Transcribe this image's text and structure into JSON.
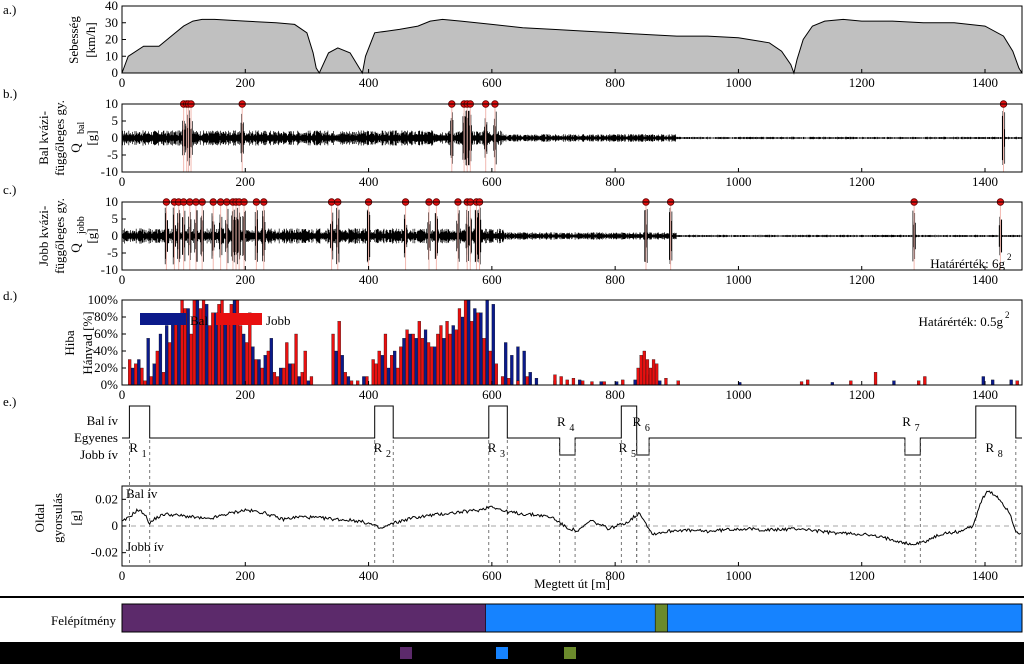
{
  "chart_data": [
    {
      "panel": "a.)",
      "type": "area",
      "ylabel_line1": "Sebesség",
      "ylabel_line2": "[km/h]",
      "xlim": [
        0,
        1460
      ],
      "ylim": [
        0,
        40
      ],
      "yticks": [
        0,
        10,
        20,
        30,
        40
      ],
      "xticks": [
        0,
        200,
        400,
        600,
        800,
        1000,
        1200,
        1400
      ],
      "color": "#c0c0c0",
      "x": [
        0,
        10,
        35,
        60,
        80,
        100,
        115,
        130,
        150,
        200,
        250,
        280,
        300,
        310,
        315,
        320,
        335,
        350,
        370,
        385,
        390,
        395,
        410,
        430,
        450,
        480,
        500,
        520,
        550,
        600,
        650,
        700,
        750,
        800,
        850,
        900,
        950,
        1000,
        1050,
        1070,
        1085,
        1090,
        1095,
        1105,
        1120,
        1140,
        1170,
        1200,
        1250,
        1300,
        1350,
        1400,
        1430,
        1445,
        1455,
        1460
      ],
      "y": [
        0,
        10,
        16,
        16,
        22,
        28,
        31,
        32,
        32,
        31,
        30,
        29,
        24,
        12,
        3,
        0,
        12,
        15,
        12,
        3,
        0,
        10,
        24,
        25,
        26,
        28,
        31,
        32,
        31,
        29,
        27,
        26,
        25,
        24,
        23,
        22,
        22,
        21,
        18,
        13,
        5,
        0,
        8,
        20,
        28,
        31,
        32,
        31,
        31,
        30,
        30,
        28,
        22,
        13,
        3,
        0
      ]
    },
    {
      "panel": "b.)",
      "type": "line",
      "ylabel_line1": "Bal kvázi-",
      "ylabel_line2": "függőleges gy.",
      "ylabel_line3": "Q",
      "ylabel_sub": "bal",
      "ylabel_unit": "[g]",
      "xlim": [
        0,
        1460
      ],
      "ylim": [
        -10,
        10
      ],
      "yticks": [
        -10,
        -5,
        0,
        5,
        10
      ],
      "xticks": [
        0,
        200,
        400,
        600,
        800,
        1000,
        1200,
        1400
      ],
      "exceedances_x": [
        100,
        105,
        108,
        112,
        195,
        535,
        555,
        560,
        565,
        590,
        605,
        1430
      ]
    },
    {
      "panel": "c.)",
      "type": "line",
      "ylabel_line1": "Jobb kvázi-",
      "ylabel_line2": "függőleges gy.",
      "ylabel_line3": "Q",
      "ylabel_sub": "jobb",
      "ylabel_unit": "[g]",
      "xlim": [
        0,
        1460
      ],
      "ylim": [
        -10,
        10
      ],
      "yticks": [
        -10,
        -5,
        0,
        5,
        10
      ],
      "xticks": [
        0,
        200,
        400,
        600,
        800,
        1000,
        1200,
        1400
      ],
      "annotation": "Határérték: 6g",
      "annotation_sup": "2",
      "exceedances_x": [
        72,
        85,
        92,
        100,
        110,
        120,
        130,
        148,
        160,
        170,
        180,
        185,
        190,
        198,
        218,
        230,
        340,
        350,
        400,
        460,
        498,
        510,
        545,
        560,
        565,
        575,
        580,
        850,
        890,
        1285,
        1425
      ]
    },
    {
      "panel": "d.)",
      "type": "bar",
      "ylabel_line1": "Hiba",
      "ylabel_line2": "Hányad [%]",
      "xlim": [
        0,
        1460
      ],
      "ylim": [
        0,
        100
      ],
      "yticks": [
        "0%",
        "20%",
        "40%",
        "60%",
        "80%",
        "100%"
      ],
      "xticks": [
        0,
        200,
        400,
        600,
        800,
        1000,
        1200,
        1400
      ],
      "legend": [
        "Bal",
        "Jobb"
      ],
      "legend_location": "top-left",
      "annotation": "Határérték: 0.5g",
      "annotation_sup": "2",
      "bin_width": 5,
      "series": [
        {
          "name": "Bal",
          "color": "#0b1a8a",
          "x": [
            15,
            25,
            40,
            50,
            60,
            70,
            80,
            90,
            105,
            120,
            135,
            150,
            165,
            180,
            195,
            210,
            220,
            230,
            240,
            255,
            270,
            285,
            300,
            345,
            355,
            365,
            390,
            420,
            430,
            440,
            455,
            465,
            475,
            490,
            505,
            520,
            535,
            550,
            560,
            570,
            580,
            590,
            600,
            620,
            630,
            640,
            650,
            660,
            670,
            700,
            740,
            775,
            800,
            830,
            850,
            870,
            1000,
            1150,
            1250,
            1395,
            1410,
            1440
          ],
          "values": [
            20,
            30,
            55,
            25,
            60,
            70,
            80,
            75,
            90,
            100,
            95,
            85,
            80,
            100,
            60,
            45,
            30,
            35,
            55,
            20,
            25,
            10,
            5,
            40,
            35,
            10,
            10,
            35,
            20,
            40,
            55,
            60,
            55,
            65,
            45,
            55,
            70,
            80,
            100,
            90,
            85,
            100,
            95,
            50,
            35,
            45,
            40,
            15,
            8,
            5,
            6,
            4,
            4,
            6,
            12,
            5,
            3,
            3,
            5,
            10,
            6,
            6
          ]
        },
        {
          "name": "Jobb",
          "color": "#e81010",
          "x": [
            10,
            20,
            30,
            35,
            45,
            55,
            65,
            75,
            85,
            95,
            100,
            110,
            115,
            125,
            130,
            140,
            145,
            155,
            160,
            170,
            175,
            185,
            190,
            200,
            205,
            215,
            225,
            235,
            245,
            250,
            260,
            265,
            275,
            280,
            290,
            295,
            305,
            340,
            350,
            360,
            370,
            380,
            395,
            405,
            410,
            415,
            425,
            435,
            445,
            450,
            460,
            470,
            480,
            485,
            495,
            500,
            510,
            515,
            525,
            530,
            540,
            545,
            555,
            565,
            575,
            585,
            595,
            605,
            615,
            625,
            640,
            655,
            700,
            710,
            720,
            730,
            745,
            760,
            780,
            810,
            835,
            840,
            845,
            850,
            855,
            860,
            865,
            880,
            900,
            1100,
            1110,
            1180,
            1220,
            1290,
            1300,
            1450
          ],
          "values": [
            30,
            25,
            20,
            5,
            10,
            40,
            15,
            50,
            75,
            100,
            90,
            60,
            100,
            90,
            100,
            70,
            85,
            95,
            100,
            80,
            95,
            100,
            70,
            50,
            85,
            30,
            20,
            40,
            15,
            10,
            20,
            50,
            25,
            60,
            15,
            40,
            10,
            60,
            75,
            15,
            5,
            5,
            10,
            30,
            25,
            40,
            60,
            35,
            20,
            45,
            65,
            60,
            75,
            55,
            50,
            45,
            60,
            70,
            75,
            60,
            65,
            90,
            100,
            75,
            85,
            55,
            40,
            25,
            10,
            8,
            5,
            10,
            12,
            10,
            6,
            8,
            5,
            4,
            4,
            6,
            20,
            35,
            40,
            30,
            20,
            30,
            25,
            8,
            5,
            4,
            6,
            5,
            15,
            5,
            10,
            5
          ]
        }
      ]
    },
    {
      "panel": "e.)",
      "type": "line",
      "ylabels": [
        "Bal ív",
        "Egyenes",
        "Jobb ív"
      ],
      "xlim": [
        0,
        1460
      ],
      "curve_labels": [
        "R1",
        "R2",
        "R3",
        "R4",
        "R5",
        "R6",
        "R7",
        "R8"
      ],
      "curve_segments": [
        {
          "label": "R1",
          "type": "bal",
          "start": 12,
          "end": 45
        },
        {
          "label": "R2",
          "type": "bal",
          "start": 410,
          "end": 440
        },
        {
          "label": "R3",
          "type": "bal",
          "start": 595,
          "end": 625
        },
        {
          "label": "R4",
          "type": "jobb",
          "start": 710,
          "end": 735
        },
        {
          "label": "R5",
          "type": "bal",
          "start": 810,
          "end": 835
        },
        {
          "label": "R6",
          "type": "jobb",
          "start": 835,
          "end": 855
        },
        {
          "label": "R7",
          "type": "jobb",
          "start": 1270,
          "end": 1295
        },
        {
          "label": "R8",
          "type": "bal",
          "start": 1385,
          "end": 1450
        }
      ]
    },
    {
      "panel": "lateral",
      "type": "line",
      "ylabel_line1": "Oldal",
      "ylabel_line2": "gyorsulás",
      "ylabel_line3": "[g]",
      "xlabel": "Megtett út [m]",
      "xlim": [
        0,
        1460
      ],
      "ylim": [
        -0.03,
        0.03
      ],
      "yticks": [
        "-0.02",
        "0",
        "0.02"
      ],
      "xticks": [
        0,
        200,
        400,
        600,
        800,
        1000,
        1200,
        1400
      ],
      "text_top": "Bal ív",
      "text_bottom": "Jobb ív",
      "x": [
        0,
        10,
        25,
        35,
        45,
        55,
        70,
        90,
        110,
        140,
        170,
        200,
        230,
        260,
        290,
        320,
        350,
        380,
        400,
        420,
        440,
        470,
        500,
        540,
        580,
        600,
        620,
        650,
        680,
        700,
        720,
        740,
        760,
        790,
        820,
        840,
        860,
        900,
        950,
        1000,
        1050,
        1100,
        1150,
        1200,
        1250,
        1280,
        1300,
        1330,
        1360,
        1380,
        1395,
        1405,
        1420,
        1440,
        1450,
        1460
      ],
      "y": [
        0.003,
        0.006,
        0.012,
        0.01,
        0.002,
        0.006,
        0.009,
        0.008,
        0.007,
        0.005,
        0.009,
        0.012,
        0.01,
        0.005,
        0.007,
        0.006,
        0.005,
        0.004,
        0.002,
        -0.002,
        0.002,
        0.006,
        0.008,
        0.01,
        0.012,
        0.015,
        0.011,
        0.009,
        0.008,
        0.006,
        -0.001,
        -0.004,
        0.004,
        -0.002,
        0.003,
        0.01,
        -0.006,
        -0.003,
        -0.004,
        -0.002,
        -0.003,
        -0.002,
        -0.005,
        -0.006,
        -0.01,
        -0.014,
        -0.012,
        -0.006,
        -0.004,
        0.0,
        0.02,
        0.026,
        0.022,
        0.01,
        -0.004,
        -0.006
      ]
    },
    {
      "panel": "structure",
      "type": "bar",
      "ylabel": "Felépítmény",
      "xlim": [
        0,
        1460
      ],
      "segments": [
        {
          "start": 0,
          "end": 590,
          "color": "#5c2a6b"
        },
        {
          "start": 590,
          "end": 865,
          "color": "#1683ff"
        },
        {
          "start": 865,
          "end": 885,
          "color": "#6b8a2c"
        },
        {
          "start": 885,
          "end": 1460,
          "color": "#1683ff"
        }
      ],
      "legend_colors": [
        "#5c2a6b",
        "#1683ff",
        "#6b8a2c"
      ]
    }
  ]
}
